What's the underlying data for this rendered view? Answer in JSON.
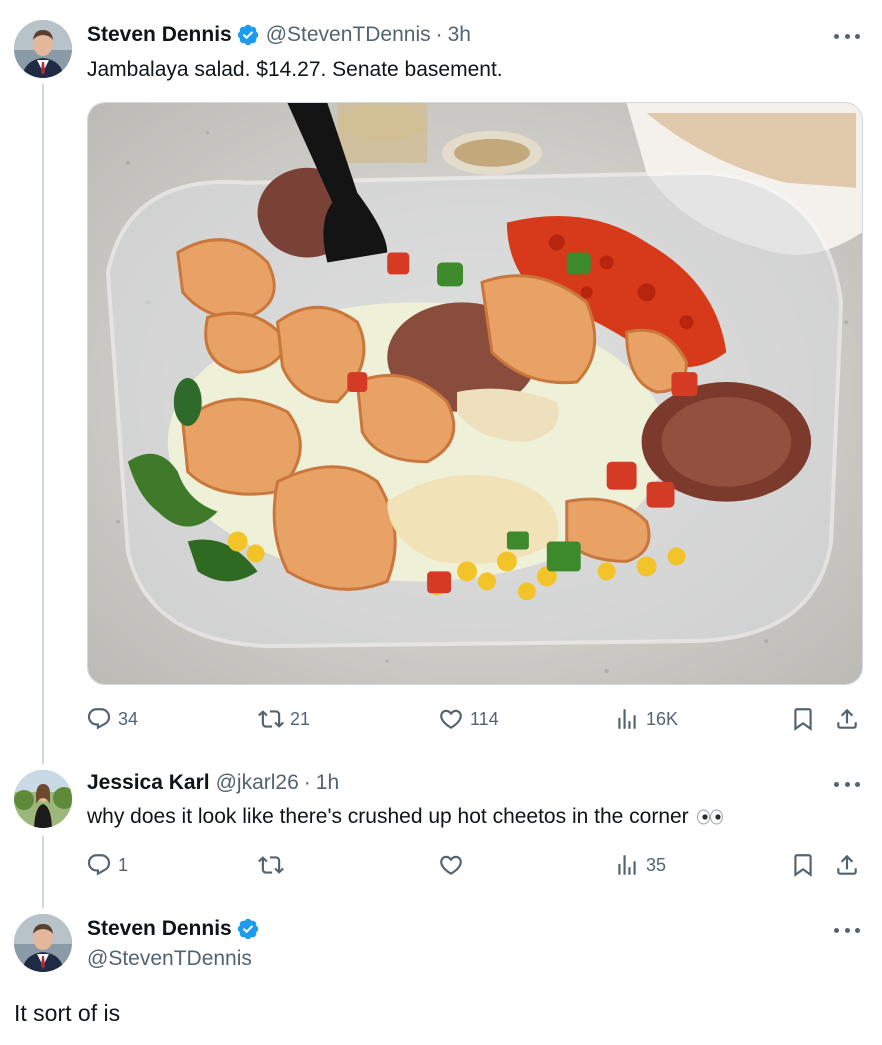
{
  "colors": {
    "text": "#0f1419",
    "muted": "#536471",
    "verified": "#1d9bf0",
    "thread_line": "#cfd9de"
  },
  "main_tweet": {
    "name": "Steven Dennis",
    "handle": "@StevenTDennis",
    "separator": "·",
    "time": "3h",
    "text": "Jambalaya salad. $14.27. Senate basement.",
    "verified": true,
    "media_description_icon": "food-photo",
    "actions": {
      "replies": "34",
      "reposts": "21",
      "likes": "114",
      "views": "16K"
    }
  },
  "reply": {
    "name": "Jessica Karl",
    "handle": "@jkarl26",
    "separator": "·",
    "time": "1h",
    "text": "why does it look like there's crushed up hot cheetos in the corner",
    "emoji_icon": "eyes-emoji",
    "actions": {
      "replies": "1",
      "reposts": "",
      "likes": "",
      "views": "35"
    }
  },
  "focused_tweet": {
    "name": "Steven Dennis",
    "handle": "@StevenTDennis",
    "text": "It sort of is",
    "verified": true
  }
}
